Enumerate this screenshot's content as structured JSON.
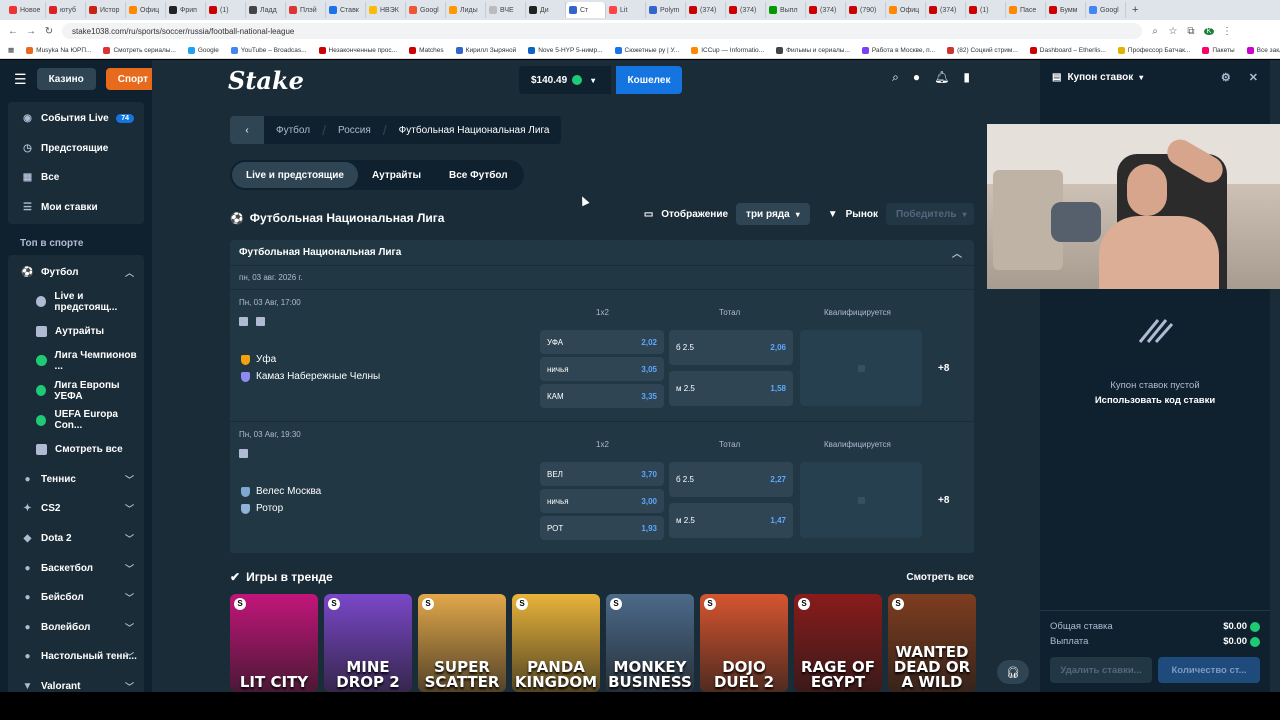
{
  "browser": {
    "tabs": [
      "Новое",
      "ютуб",
      "Истор",
      "Офиц",
      "Фрип",
      "(1)",
      "Ладд",
      "Плэй",
      "Ставк",
      "НВЭК",
      "Googl",
      "Лиды",
      "ВЧЕ",
      "Ди",
      "Ст",
      "Lit",
      "Polym",
      "(374)",
      "(374)",
      "Выпл",
      "(374)",
      "(790)",
      "Офиц",
      "(374)",
      "(1)",
      "Пасе",
      "Бумм",
      "Googl"
    ],
    "url": "stake1038.com/ru/sports/soccer/russia/football-national-league",
    "bookmarks": [
      "Musyka Na ЮРП...",
      "Смотреть сериалы...",
      "Google",
      "YouTube – Broadcas...",
      "Незаконченные прос...",
      "Matches",
      "Кирилл Зыряной",
      "Nove 5-HYP 5-нимр...",
      "Сюжетные ру | У...",
      "ICCup — Informatio...",
      "Фильмы и сериалы...",
      "Работа в Москве, п...",
      "(82) Соцкий стрим...",
      "Dashboard – Etherlis...",
      "Профессор Батчак...",
      "Пакеты",
      "Все закладки"
    ]
  },
  "header": {
    "casino": "Казино",
    "sport": "Спорт",
    "logo": "Stake",
    "balance": "$140.49",
    "wallet": "Кошелек"
  },
  "sidebar": {
    "top": [
      {
        "label": "События Live",
        "badge": "74",
        "icon": "live-icon"
      },
      {
        "label": "Предстоящие",
        "icon": "clock-icon"
      },
      {
        "label": "Все",
        "icon": "grid-icon"
      },
      {
        "label": "Мои ставки",
        "icon": "list-icon"
      }
    ],
    "section_title": "Топ в спорте",
    "football": "Футбол",
    "football_sub": [
      {
        "label": "Live и предстоящ...",
        "color": "#b1bad3"
      },
      {
        "label": "Аутрайты",
        "color": "#b1bad3"
      },
      {
        "label": "Лига Чемпионов ...",
        "color": "#1fca74"
      },
      {
        "label": "Лига Европы УЕФА",
        "color": "#1fca74"
      },
      {
        "label": "UEFA Europa Con...",
        "color": "#1fca74"
      },
      {
        "label": "Смотреть все",
        "color": "#b1bad3"
      }
    ],
    "sports": [
      "Теннис",
      "CS2",
      "Dota 2",
      "Баскетбол",
      "Бейсбол",
      "Волейбол",
      "Настольный тенн...",
      "Valorant"
    ]
  },
  "breadcrumb": {
    "items": [
      "Футбол",
      "Россия",
      "Футбольная Национальная Лига"
    ]
  },
  "tabs": [
    "Live и предстоящие",
    "Аутрайты",
    "Все Футбол"
  ],
  "league": {
    "title": "Футбольная Национальная Лига",
    "display_label": "Отображение",
    "display_value": "три ряда",
    "market_label": "Рынок",
    "market_value": "Победитель"
  },
  "card": {
    "header": "Футбольная Национальная Лига",
    "date": "пн, 03 авг. 2026 г.",
    "col_1x2": "1x2",
    "col_total": "Тотал",
    "col_qual": "Квалифицируется",
    "matches": [
      {
        "time": "Пн, 03 Авг,   17:00",
        "home": "Уфа",
        "away": "Камаз Набережные Челны",
        "home_color": "#f2a20c",
        "away_color": "#8e8af0",
        "odds": [
          {
            "label": "УФА",
            "value": "2,02"
          },
          {
            "label": "ничья",
            "value": "3,05"
          },
          {
            "label": "КАМ",
            "value": "3,35"
          }
        ],
        "totals": [
          {
            "label": "б 2.5",
            "value": "2,06"
          },
          {
            "label": "м 2.5",
            "value": "1,58"
          }
        ],
        "more": "+8"
      },
      {
        "time": "Пн, 03 Авг,   19:30",
        "home": "Велес Москва",
        "away": "Ротор",
        "home_color": "#7fa8d0",
        "away_color": "#8fb2d6",
        "odds": [
          {
            "label": "ВЕЛ",
            "value": "3,70"
          },
          {
            "label": "ничья",
            "value": "3,00"
          },
          {
            "label": "РОТ",
            "value": "1,93"
          }
        ],
        "totals": [
          {
            "label": "б 2.5",
            "value": "2,27"
          },
          {
            "label": "м 2.5",
            "value": "1,47"
          }
        ],
        "more": "+8"
      }
    ]
  },
  "trending": {
    "title": "Игры в тренде",
    "see_all": "Смотреть все",
    "games": [
      {
        "title": "LIT CITY",
        "color": "#c3157a"
      },
      {
        "title": "MINE DROP 2",
        "color": "#7a47c9"
      },
      {
        "title": "SUPER SCATTER",
        "color": "#e2a84a"
      },
      {
        "title": "PANDA KINGDOM",
        "color": "#e8b43a"
      },
      {
        "title": "MONKEY BUSINESS",
        "color": "#4b6a8a"
      },
      {
        "title": "DOJO DUEL 2",
        "color": "#d6552f"
      },
      {
        "title": "RAGE OF EGYPT",
        "color": "#8a1b1b"
      },
      {
        "title": "WANTED DEAD OR A WILD",
        "color": "#7e3d1f"
      }
    ]
  },
  "betslip": {
    "title": "Купон ставок",
    "empty": "Купон ставок пустой",
    "code": "Использовать код ставки",
    "total_stake_label": "Общая ставка",
    "total_stake": "$0.00",
    "payout_label": "Выплата",
    "payout": "$0.00",
    "delete_btn": "Удалить ставки...",
    "count_btn": "Количество ст..."
  }
}
